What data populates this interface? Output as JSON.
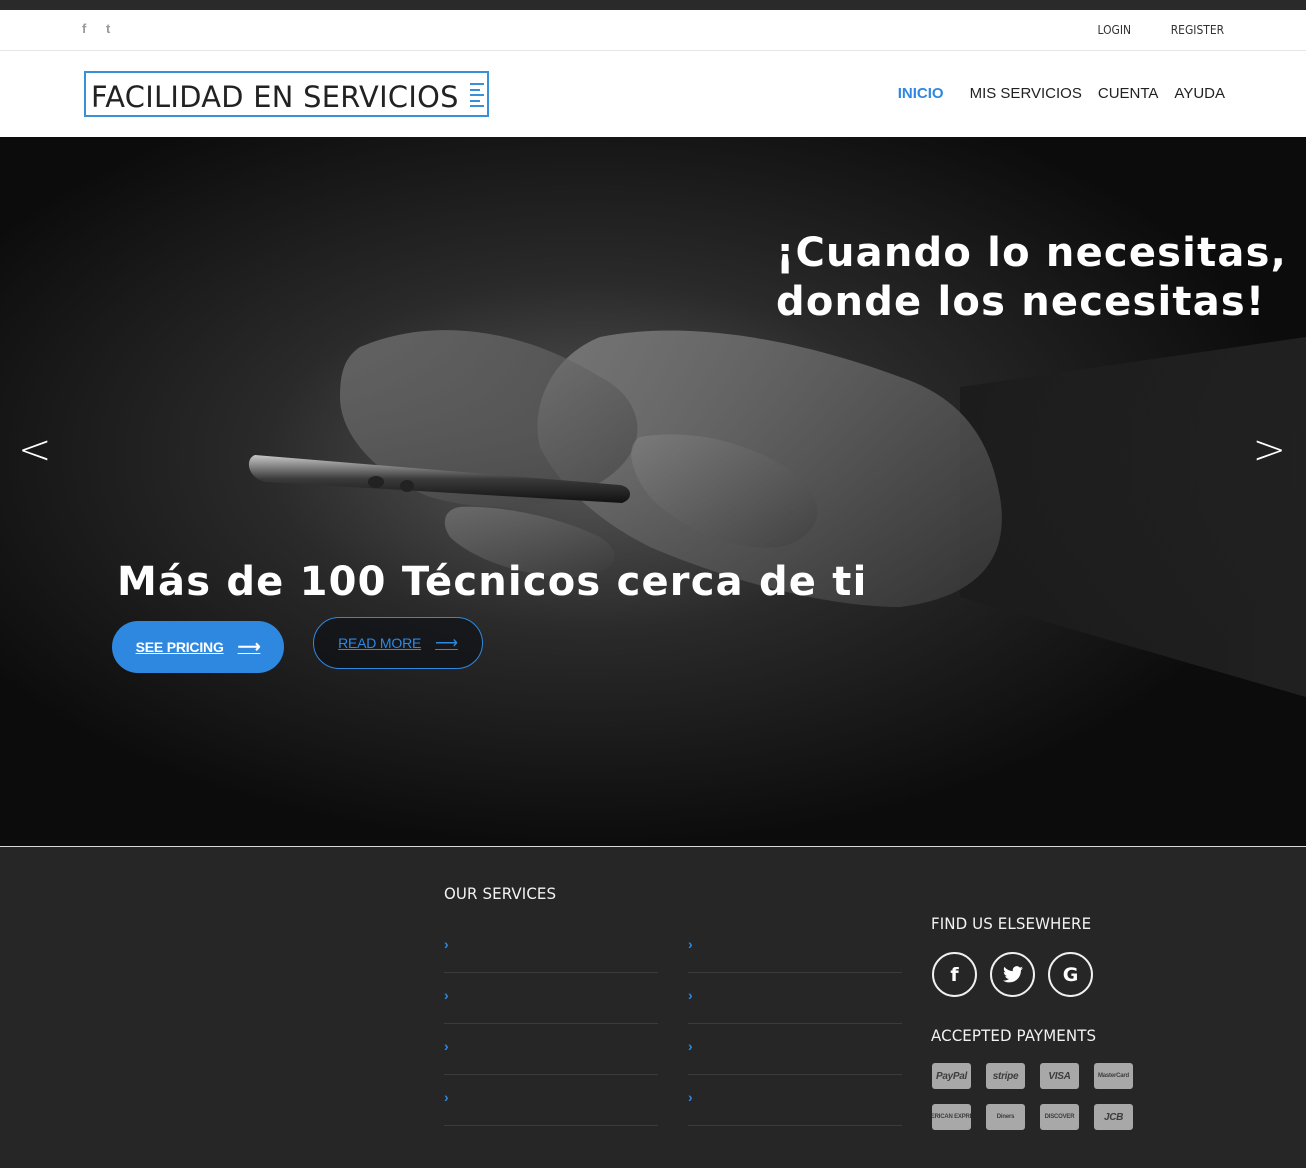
{
  "topbar": {
    "social_icons": [
      "facebook-icon",
      "twitter-icon"
    ],
    "facebook_glyph": "f",
    "twitter_glyph": "t",
    "login": "LOGIN",
    "register": "REGISTER"
  },
  "navbar": {
    "logo": "FACILIDAD EN SERVICIOS",
    "menu": [
      {
        "label": "INICIO",
        "active": true
      },
      {
        "label": "MIS SERVICIOS",
        "active": false
      },
      {
        "label": "CUENTA",
        "active": false
      },
      {
        "label": "AYUDA",
        "active": false
      }
    ],
    "accent_color": "#2f88e0"
  },
  "hero": {
    "headline_line1": "¡Cuando lo necesitas,",
    "headline_line2": "donde los necesitas!",
    "subheadline": "Más de 100 Técnicos cerca de ti",
    "prev_arrow": "<",
    "next_arrow": ">",
    "see_pricing": "SEE PRICING",
    "read_more": "READ MORE",
    "button_arrow": "⟶"
  },
  "footer": {
    "services_title": "OUR SERVICES",
    "chevron": "›",
    "services_col1": [
      "",
      "",
      "",
      ""
    ],
    "services_col2": [
      "",
      "",
      "",
      ""
    ],
    "find_title": "FIND US ELSEWHERE",
    "social_glyphs": {
      "facebook": "f",
      "twitter": "🐦",
      "google": "G"
    },
    "payments_title": "ACCEPTED PAYMENTS",
    "payments": [
      "PayPal",
      "stripe",
      "VISA",
      "MasterCard",
      "AMERICAN EXPRESS",
      "Diners",
      "DISCOVER",
      "JCB"
    ]
  }
}
